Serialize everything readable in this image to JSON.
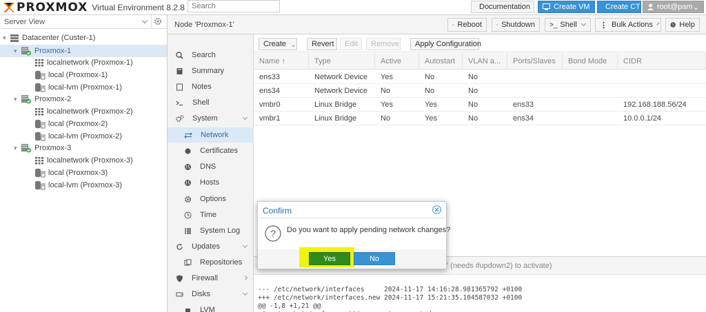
{
  "topbar": {
    "logo_text": "PROXMOX",
    "product": "Virtual Environment 8.2.8",
    "search_placeholder": "Search",
    "documentation": "Documentation",
    "create_vm": "Create VM",
    "create_ct": "Create CT",
    "user": "root@pam"
  },
  "sidebar": {
    "view": "Server View",
    "tree": [
      {
        "label": "Datacenter (Custer-1)",
        "icon": "datacenter-icon"
      },
      {
        "label": "Proxmox-1",
        "icon": "node-online-icon"
      },
      {
        "label": "localnetwork (Proxmox-1)",
        "icon": "network-grid-icon"
      },
      {
        "label": "local (Proxmox-1)",
        "icon": "storage-icon"
      },
      {
        "label": "local-lvm (Proxmox-1)",
        "icon": "storage-icon"
      },
      {
        "label": "Proxmox-2",
        "icon": "node-online-icon"
      },
      {
        "label": "localnetwork (Proxmox-2)",
        "icon": "network-grid-icon"
      },
      {
        "label": "local (Proxmox-2)",
        "icon": "storage-icon"
      },
      {
        "label": "local-lvm (Proxmox-2)",
        "icon": "storage-icon"
      },
      {
        "label": "Proxmox-3",
        "icon": "node-online-icon"
      },
      {
        "label": "localnetwork (Proxmox-3)",
        "icon": "network-grid-icon"
      },
      {
        "label": "local (Proxmox-3)",
        "icon": "storage-icon"
      },
      {
        "label": "local-lvm (Proxmox-3)",
        "icon": "storage-icon"
      }
    ]
  },
  "node": {
    "title": "Node 'Proxmox-1'",
    "reboot": "Reboot",
    "shutdown": "Shutdown",
    "shell": "Shell",
    "bulk_actions": "Bulk Actions",
    "help": "Help"
  },
  "menu": [
    {
      "label": "Search",
      "icon": "search-icon"
    },
    {
      "label": "Summary",
      "icon": "book-icon"
    },
    {
      "label": "Notes",
      "icon": "notes-icon"
    },
    {
      "label": "Shell",
      "icon": "terminal-icon"
    },
    {
      "label": "System",
      "icon": "gears-icon"
    },
    {
      "label": "Network",
      "icon": "network-arrows-icon"
    },
    {
      "label": "Certificates",
      "icon": "certificate-icon"
    },
    {
      "label": "DNS",
      "icon": "globe-icon"
    },
    {
      "label": "Hosts",
      "icon": "globe-icon"
    },
    {
      "label": "Options",
      "icon": "gear-icon"
    },
    {
      "label": "Time",
      "icon": "clock-icon"
    },
    {
      "label": "System Log",
      "icon": "list-icon"
    },
    {
      "label": "Updates",
      "icon": "refresh-icon"
    },
    {
      "label": "Repositories",
      "icon": "repository-icon"
    },
    {
      "label": "Firewall",
      "icon": "shield-icon"
    },
    {
      "label": "Disks",
      "icon": "disk-icon"
    },
    {
      "label": "LVM",
      "icon": "square-icon"
    }
  ],
  "toolbar": {
    "create": "Create",
    "revert": "Revert",
    "edit": "Edit",
    "remove": "Remove",
    "apply": "Apply Configuration"
  },
  "grid": {
    "columns": [
      "Name ↑",
      "Type",
      "Active",
      "Autostart",
      "VLAN a...",
      "Ports/Slaves",
      "Bond Mode",
      "CIDR"
    ],
    "rows": [
      [
        "ens33",
        "Network Device",
        "Yes",
        "No",
        "No",
        "",
        "",
        ""
      ],
      [
        "ens34",
        "Network Device",
        "No",
        "No",
        "No",
        "",
        "",
        ""
      ],
      [
        "vmbr0",
        "Linux Bridge",
        "Yes",
        "Yes",
        "No",
        "ens33",
        "",
        "192.168.188.56/24"
      ],
      [
        "vmbr1",
        "Linux Bridge",
        "No",
        "Yes",
        "No",
        "ens34",
        "",
        "10.0.0.1/24"
      ]
    ]
  },
  "pending": {
    "notice": "' (needs ifupdown2) to activate)",
    "diff": [
      "--- /etc/network/interfaces     2024-11-17 14:16:28.981365792 +0100",
      "+++ /etc/network/interfaces.new 2024-11-17 15:21:35.104587032 +0100",
      "@@ -1,8 +1,21 @@",
      "+# network interface settings; autogenerated"
    ]
  },
  "dialog": {
    "title": "Confirm",
    "message": "Do you want to apply pending network changes?",
    "yes": "Yes",
    "no": "No"
  },
  "colors": {
    "accent": "#3892d4",
    "yes_button": "#2f8b1b",
    "highlight": "#eef312",
    "online": "#4caf50"
  }
}
